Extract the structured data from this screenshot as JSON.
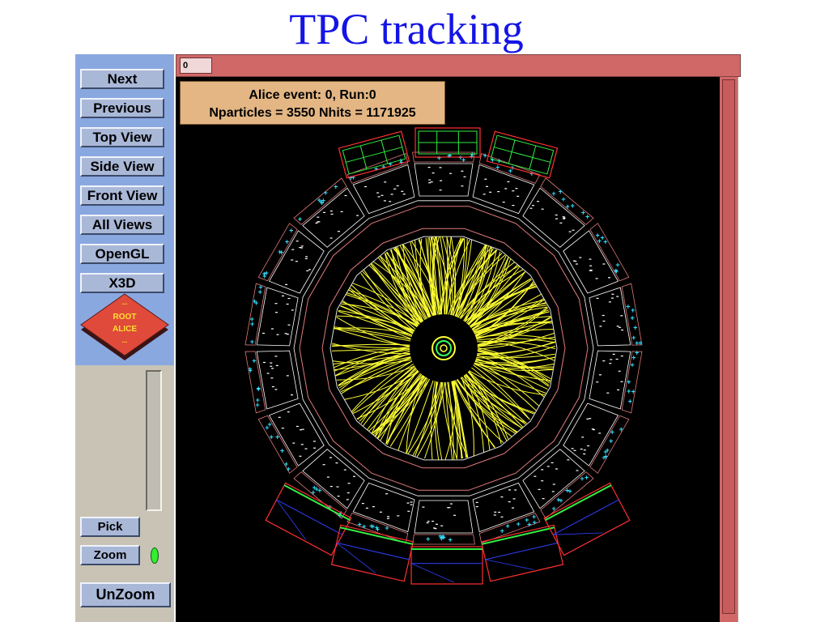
{
  "slide": {
    "title": "TPC tracking"
  },
  "sidebar": {
    "buttons": [
      {
        "label": "Next"
      },
      {
        "label": "Previous"
      },
      {
        "label": "Top View"
      },
      {
        "label": "Side View"
      },
      {
        "label": "Front View"
      },
      {
        "label": "All Views"
      },
      {
        "label": "OpenGL"
      },
      {
        "label": "X3D"
      }
    ],
    "logo": {
      "top": "...",
      "line1": "ROOT",
      "line2": "ALICE",
      "bottom": "..."
    },
    "pick_label": "Pick",
    "zoom_label": "Zoom",
    "unzoom_label": "UnZoom"
  },
  "toolbar": {
    "slider_value": "0"
  },
  "event_info": {
    "line1": "Alice event: 0, Run:0",
    "line2": "Nparticles = 3550  Nhits = 1171925"
  },
  "colors": {
    "slide_title": "#1414e6",
    "button_panel": "#8aa8e0",
    "canvas_background": "#000000",
    "tracks": "#ffff33",
    "hits": "#33e0ff",
    "detector_outline": "#ff3030",
    "info_box": "#e3b684",
    "frame": "#d06868"
  }
}
